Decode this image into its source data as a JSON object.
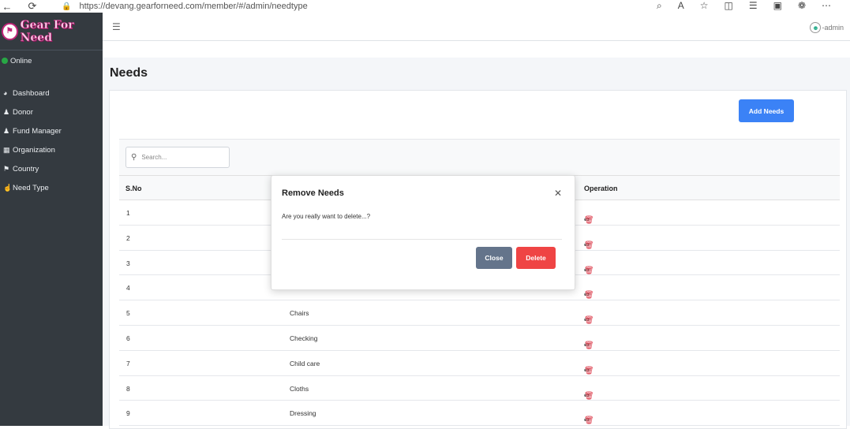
{
  "browser": {
    "url": "https://devang.gearforneed.com/member/#/admin/needtype"
  },
  "brand": {
    "name": "Gear For Need"
  },
  "status": {
    "text": "Online",
    "color": "#28a745"
  },
  "sidebar": {
    "items": [
      {
        "label": "Dashboard",
        "icon": "chart-pie-icon"
      },
      {
        "label": "Donor",
        "icon": "users-icon"
      },
      {
        "label": "Fund Manager",
        "icon": "user-icon"
      },
      {
        "label": "Organization",
        "icon": "sitemap-icon"
      },
      {
        "label": "Country",
        "icon": "flag-icon"
      },
      {
        "label": "Need Type",
        "icon": "hand-holding-icon"
      }
    ]
  },
  "header": {
    "user": "admin"
  },
  "page": {
    "title": "Needs"
  },
  "toolbar": {
    "add_label": "Add Needs",
    "add_color": "#3b82f6"
  },
  "search": {
    "placeholder": "Search..."
  },
  "table": {
    "columns": [
      "S.No",
      "Operation"
    ],
    "rows": [
      {
        "sno": "1",
        "name": ""
      },
      {
        "sno": "2",
        "name": ""
      },
      {
        "sno": "3",
        "name": ""
      },
      {
        "sno": "4",
        "name": ""
      },
      {
        "sno": "5",
        "name": "Chairs"
      },
      {
        "sno": "6",
        "name": "Checking"
      },
      {
        "sno": "7",
        "name": "Child care"
      },
      {
        "sno": "8",
        "name": "Cloths"
      },
      {
        "sno": "9",
        "name": "Dressing"
      }
    ]
  },
  "modal": {
    "title": "Remove Needs",
    "body": "Are you really want to delete...?",
    "close_label": "Close",
    "delete_label": "Delete",
    "delete_color": "#ef4444"
  }
}
